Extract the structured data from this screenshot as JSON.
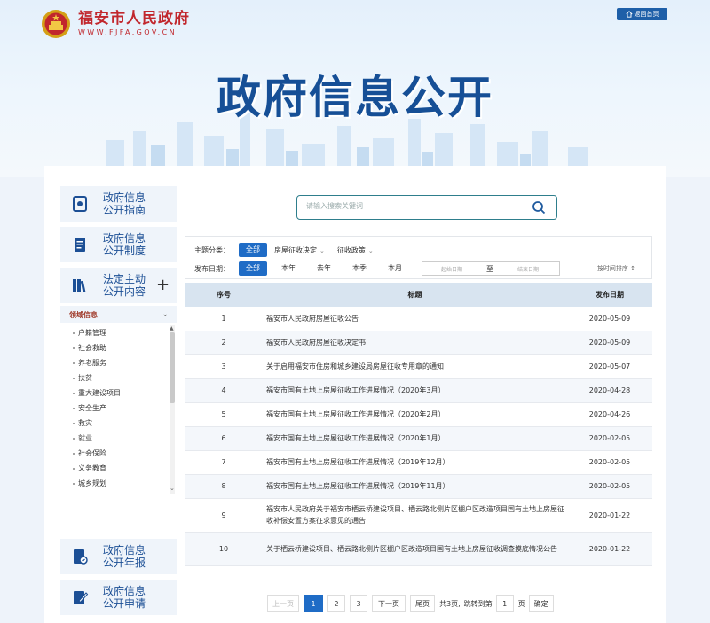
{
  "header": {
    "site_title": "福安市人民政府",
    "site_url": "WWW.FJFA.GOV.CN",
    "home_button": "返回首页",
    "hero_title": "政府信息公开"
  },
  "sidebar": {
    "items": [
      {
        "label": "政府信息公开指南",
        "line1": "政府信息",
        "line2": "公开指南",
        "icon": "guide-icon"
      },
      {
        "label": "政府信息公开制度",
        "line1": "政府信息",
        "line2": "公开制度",
        "icon": "document-icon"
      },
      {
        "label": "法定主动公开内容",
        "line1": "法定主动",
        "line2": "公开内容",
        "icon": "books-icon"
      },
      {
        "label": "政府信息公开年报",
        "line1": "政府信息",
        "line2": "公开年报",
        "icon": "annual-report-icon"
      },
      {
        "label": "政府信息公开申请",
        "line1": "政府信息",
        "line2": "公开申请",
        "icon": "apply-icon"
      }
    ],
    "expand_symbol": "+",
    "domain": {
      "title": "领域信息",
      "items": [
        "户籍管理",
        "社会救助",
        "养老服务",
        "扶贫",
        "重大建设项目",
        "安全生产",
        "救灾",
        "就业",
        "社会保险",
        "义务教育",
        "城乡规划"
      ]
    }
  },
  "search": {
    "placeholder": "请输入搜索关键词"
  },
  "filters": {
    "topic_label": "主题分类：",
    "topic_all": "全部",
    "topic_options": [
      "房屋征收决定",
      "征收政策"
    ],
    "date_label": "发布日期：",
    "date_all": "全部",
    "date_options": [
      "本年",
      "去年",
      "本季",
      "本月"
    ],
    "date_from_placeholder": "起始日期",
    "date_to": "至",
    "date_to_placeholder": "结束日期",
    "sort_label": "按时间排序 ↕"
  },
  "table": {
    "headers": [
      "序号",
      "标题",
      "发布日期"
    ],
    "rows": [
      {
        "idx": "1",
        "title": "福安市人民政府房屋征收公告",
        "date": "2020-05-09"
      },
      {
        "idx": "2",
        "title": "福安市人民政府房屋征收决定书",
        "date": "2020-05-09"
      },
      {
        "idx": "3",
        "title": "关于启用福安市住房和城乡建设局房屋征收专用章的通知",
        "date": "2020-05-07"
      },
      {
        "idx": "4",
        "title": "福安市国有土地上房屋征收工作进展情况（2020年3月）",
        "date": "2020-04-28"
      },
      {
        "idx": "5",
        "title": "福安市国有土地上房屋征收工作进展情况（2020年2月）",
        "date": "2020-04-26"
      },
      {
        "idx": "6",
        "title": "福安市国有土地上房屋征收工作进展情况（2020年1月）",
        "date": "2020-02-05"
      },
      {
        "idx": "7",
        "title": "福安市国有土地上房屋征收工作进展情况（2019年12月）",
        "date": "2020-02-05"
      },
      {
        "idx": "8",
        "title": "福安市国有土地上房屋征收工作进展情况（2019年11月）",
        "date": "2020-02-05"
      },
      {
        "idx": "9",
        "title": "福安市人民政府关于福安市栖云桥建设项目、栖云路北侧片区棚户区改造项目国有土地上房屋征收补偿安置方案征求意见的通告",
        "date": "2020-01-22"
      },
      {
        "idx": "10",
        "title": "关于栖云桥建设项目、栖云路北侧片区棚户区改造项目国有土地上房屋征收调查摸底情况公告",
        "date": "2020-01-22"
      }
    ]
  },
  "pagination": {
    "prev": "上一页",
    "pages": [
      "1",
      "2",
      "3"
    ],
    "current": "1",
    "next": "下一页",
    "last": "尾页",
    "total": "共3页,",
    "goto_label": "跳转到第",
    "goto_value": "1",
    "page_unit": "页",
    "confirm": "确定"
  },
  "colors": {
    "brand_red": "#c1272d",
    "hero_blue": "#164f96",
    "accent_blue": "#1f6cc6"
  }
}
